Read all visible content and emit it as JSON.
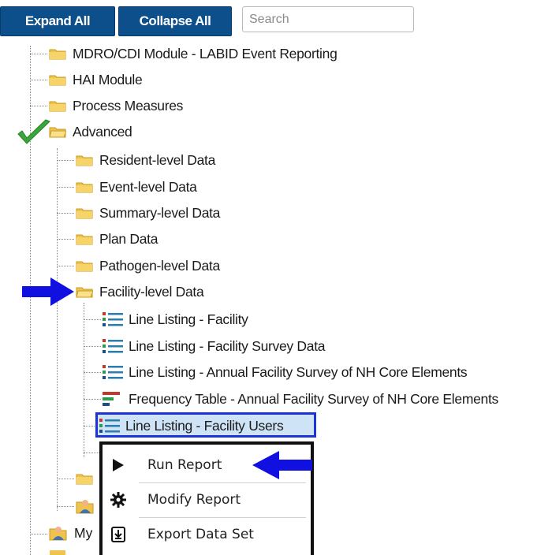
{
  "toolbar": {
    "expand_all": "Expand All",
    "collapse_all": "Collapse All",
    "search_placeholder": "Search"
  },
  "tree": {
    "top_items": [
      "MDRO/CDI Module - LABID Event Reporting",
      "HAI Module",
      "Process Measures",
      "Advanced"
    ],
    "advanced_children": [
      "Resident-level Data",
      "Event-level Data",
      "Summary-level Data",
      "Plan Data",
      "Pathogen-level Data",
      "Facility-level Data"
    ],
    "facility_reports": [
      {
        "label": "Line Listing - Facility",
        "icon": "line-listing-icon"
      },
      {
        "label": "Line Listing - Facility Survey Data",
        "icon": "line-listing-icon"
      },
      {
        "label": "Line Listing - Annual Facility Survey of NH Core Elements",
        "icon": "line-listing-icon"
      },
      {
        "label": "Frequency Table - Annual Facility Survey of NH Core Elements",
        "icon": "frequency-table-icon"
      },
      {
        "label": "Line Listing - Facility Users",
        "icon": "line-listing-icon"
      }
    ],
    "partial_item": "My"
  },
  "context_menu": {
    "items": [
      {
        "label": "Run Report",
        "icon": "play-icon"
      },
      {
        "label": "Modify Report",
        "icon": "gear-icon"
      },
      {
        "label": "Export Data Set",
        "icon": "export-icon"
      }
    ]
  },
  "colors": {
    "button_bg": "#0d4f8b",
    "annotation_arrow": "#1010e0",
    "checkmark": "#3aa63a",
    "selection_border": "#1b33d8"
  }
}
